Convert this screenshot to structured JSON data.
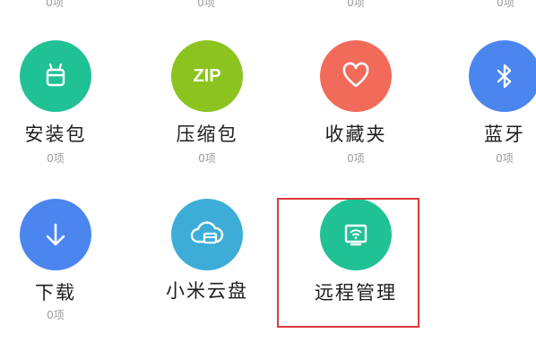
{
  "colors": {
    "teal": "#21c196",
    "green": "#8cc31f",
    "coral": "#f26a5a",
    "blue": "#4b86ef",
    "sky": "#3dadd8",
    "highlight": "#e0383b"
  },
  "top_row_counts": [
    "0项",
    "0项",
    "0项",
    "0项"
  ],
  "items": [
    {
      "label": "安装包",
      "count": "0项",
      "icon": "android-icon",
      "color": "#21c196"
    },
    {
      "label": "压缩包",
      "count": "0项",
      "icon": "zip-icon",
      "icon_text": "ZIP",
      "color": "#8cc31f"
    },
    {
      "label": "收藏夹",
      "count": "0项",
      "icon": "heart-icon",
      "color": "#f26a5a"
    },
    {
      "label": "蓝牙",
      "count": "0项",
      "icon": "bluetooth-icon",
      "color": "#4b86ef"
    },
    {
      "label": "下载",
      "count": "0项",
      "icon": "download-icon",
      "color": "#4b86ef"
    },
    {
      "label": "小米云盘",
      "count": "",
      "icon": "cloud-icon",
      "color": "#3dadd8"
    },
    {
      "label": "远程管理",
      "count": "",
      "icon": "wifi-screen-icon",
      "color": "#21c196"
    }
  ]
}
